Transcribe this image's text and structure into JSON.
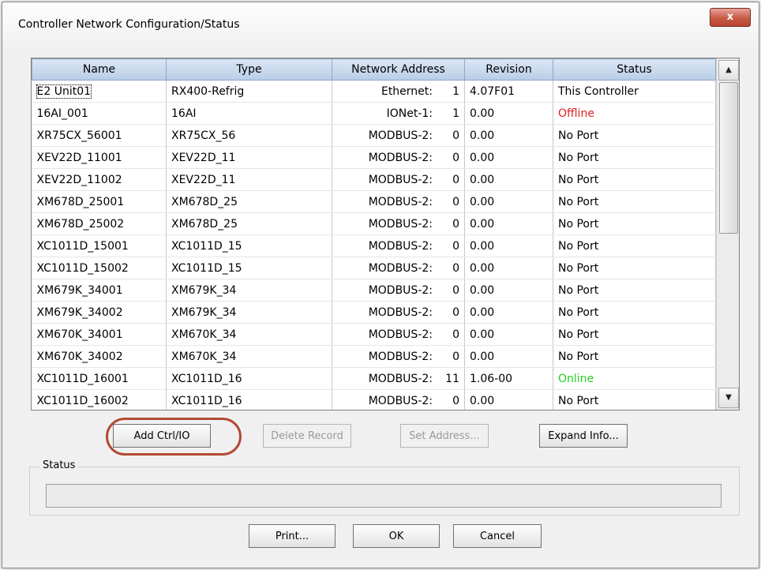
{
  "window": {
    "title": "Controller Network Configuration/Status",
    "close_symbol": "x"
  },
  "grid": {
    "columns": [
      "Name",
      "Type",
      "Network Address",
      "Revision",
      "Status"
    ],
    "rows": [
      {
        "name": "E2 Unit01",
        "type": "RX400-Refrig",
        "proto": "Ethernet:",
        "addr": "1",
        "revision": "4.07F01",
        "status": "This Controller",
        "status_color": "#000000"
      },
      {
        "name": "16AI_001",
        "type": "16AI",
        "proto": "IONet-1:",
        "addr": "1",
        "revision": "0.00",
        "status": "Offline",
        "status_color": "#e02020"
      },
      {
        "name": "XR75CX_56001",
        "type": "XR75CX_56",
        "proto": "MODBUS-2:",
        "addr": "0",
        "revision": "0.00",
        "status": "No Port",
        "status_color": "#000000"
      },
      {
        "name": "XEV22D_11001",
        "type": "XEV22D_11",
        "proto": "MODBUS-2:",
        "addr": "0",
        "revision": "0.00",
        "status": "No Port",
        "status_color": "#000000"
      },
      {
        "name": "XEV22D_11002",
        "type": "XEV22D_11",
        "proto": "MODBUS-2:",
        "addr": "0",
        "revision": "0.00",
        "status": "No Port",
        "status_color": "#000000"
      },
      {
        "name": "XM678D_25001",
        "type": "XM678D_25",
        "proto": "MODBUS-2:",
        "addr": "0",
        "revision": "0.00",
        "status": "No Port",
        "status_color": "#000000"
      },
      {
        "name": "XM678D_25002",
        "type": "XM678D_25",
        "proto": "MODBUS-2:",
        "addr": "0",
        "revision": "0.00",
        "status": "No Port",
        "status_color": "#000000"
      },
      {
        "name": "XC1011D_15001",
        "type": "XC1011D_15",
        "proto": "MODBUS-2:",
        "addr": "0",
        "revision": "0.00",
        "status": "No Port",
        "status_color": "#000000"
      },
      {
        "name": "XC1011D_15002",
        "type": "XC1011D_15",
        "proto": "MODBUS-2:",
        "addr": "0",
        "revision": "0.00",
        "status": "No Port",
        "status_color": "#000000"
      },
      {
        "name": "XM679K_34001",
        "type": "XM679K_34",
        "proto": "MODBUS-2:",
        "addr": "0",
        "revision": "0.00",
        "status": "No Port",
        "status_color": "#000000"
      },
      {
        "name": "XM679K_34002",
        "type": "XM679K_34",
        "proto": "MODBUS-2:",
        "addr": "0",
        "revision": "0.00",
        "status": "No Port",
        "status_color": "#000000"
      },
      {
        "name": "XM670K_34001",
        "type": "XM670K_34",
        "proto": "MODBUS-2:",
        "addr": "0",
        "revision": "0.00",
        "status": "No Port",
        "status_color": "#000000"
      },
      {
        "name": "XM670K_34002",
        "type": "XM670K_34",
        "proto": "MODBUS-2:",
        "addr": "0",
        "revision": "0.00",
        "status": "No Port",
        "status_color": "#000000"
      },
      {
        "name": "XC1011D_16001",
        "type": "XC1011D_16",
        "proto": "MODBUS-2:",
        "addr": "11",
        "revision": "1.06-00",
        "status": "Online",
        "status_color": "#22d022"
      },
      {
        "name": "XC1011D_16002",
        "type": "XC1011D_16",
        "proto": "MODBUS-2:",
        "addr": "0",
        "revision": "0.00",
        "status": "No Port",
        "status_color": "#000000"
      }
    ]
  },
  "buttons": {
    "add_ctrl": "Add Ctrl/IO",
    "delete_record": "Delete Record",
    "set_address": "Set Address...",
    "expand_info": "Expand Info...",
    "print": "Print...",
    "ok": "OK",
    "cancel": "Cancel"
  },
  "status_group": {
    "label": "Status",
    "value": ""
  }
}
